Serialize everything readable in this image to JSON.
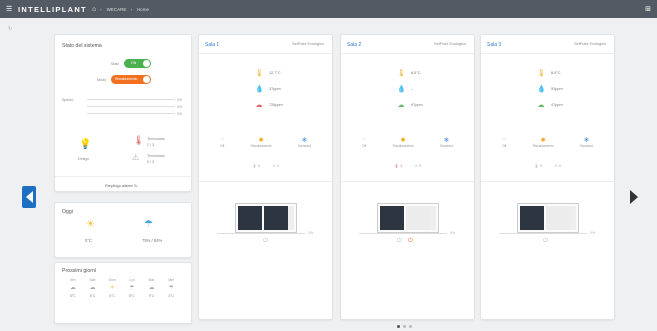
{
  "topbar": {
    "brand": "INTELLIPLANT",
    "breadcrumb": [
      "WECARE",
      "Home"
    ],
    "icons": [
      "menu-icon",
      "home-icon",
      "grid-icon"
    ]
  },
  "system": {
    "title": "Stato del sistema",
    "toggle1_label": "Stato",
    "toggle1_value": "ON",
    "toggle2_label": "Modo",
    "toggle2_value": "Riscaldamento",
    "spento_label": "Spento",
    "bars": [
      {
        "pct": "0%"
      },
      {
        "pct": "0%"
      },
      {
        "pct": "0%"
      }
    ],
    "bulb_label": "Design",
    "therm_alert_title": "Termostato",
    "therm_alert_value": "2 / 3",
    "warn_alert_title": "Termostato",
    "warn_alert_value": "0 / 3",
    "link": "Riepilogo allarmi"
  },
  "today": {
    "title": "Oggi",
    "temp": "0°C",
    "humidity": "75% / 84%"
  },
  "next_days": {
    "title": "Prossimi giorni",
    "days": [
      {
        "d": "Ven",
        "w": "cloud",
        "t": "8°C"
      },
      {
        "d": "Sab",
        "w": "cloud",
        "t": "8°C"
      },
      {
        "d": "Dom",
        "w": "sun",
        "t": "5°C"
      },
      {
        "d": "Lun",
        "w": "rain",
        "t": "8°C"
      },
      {
        "d": "Mar",
        "w": "cloud",
        "t": "9°C"
      },
      {
        "d": "Mer",
        "w": "rain",
        "t": "4°C"
      }
    ]
  },
  "rooms": [
    {
      "name": "Sala 1",
      "setpoint": "SetPoint Ecologico",
      "temp": "12.7°C",
      "hum": "37ppm",
      "air": "726ppm",
      "air_status": "bad",
      "modes": [
        "Off",
        "Riscaldamento",
        "Standard"
      ],
      "alerts_a": "0",
      "alerts_b": "0",
      "alerts_red": false,
      "slider": "0%",
      "power_on": false
    },
    {
      "name": "Sala 2",
      "setpoint": "SetPoint Ecologico",
      "temp": "8.5°C",
      "hum": "--",
      "air": "97ppm",
      "air_status": "good",
      "modes": [
        "Off",
        "Riscaldamento",
        "Standard"
      ],
      "alerts_a": "1",
      "alerts_b": "0",
      "alerts_red": true,
      "slider": "0%",
      "power_on": true
    },
    {
      "name": "Sala 3",
      "setpoint": "SetPoint Ecologico",
      "temp": "8.5°C",
      "hum": "53ppm",
      "air": "47ppm",
      "air_status": "good",
      "modes": [
        "Off",
        "Riscaldamento",
        "Standard"
      ],
      "alerts_a": "0",
      "alerts_b": "0",
      "alerts_red": false,
      "slider": "0%",
      "power_on": false
    }
  ],
  "pagination": {
    "pages": 3,
    "active": 1
  }
}
